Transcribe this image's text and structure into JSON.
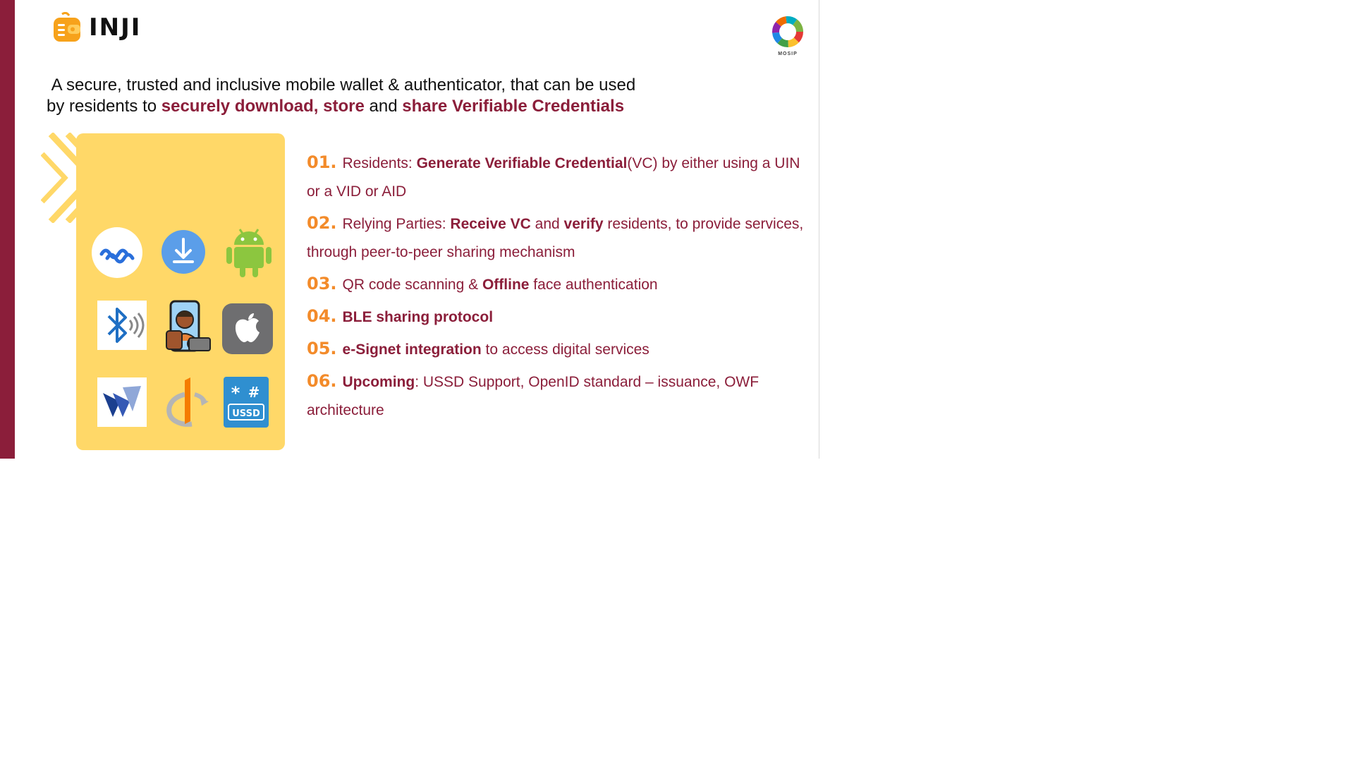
{
  "brand": {
    "name": "INJI",
    "partner_mark": "MOSIP"
  },
  "colors": {
    "maroon": "#8b1e3a",
    "orange": "#f38b2a",
    "card": "#ffd868"
  },
  "tagline": {
    "line1": "A secure, trusted and inclusive mobile wallet & authenticator, that can be used",
    "line2_prefix": "by residents to ",
    "highlight1": "securely download, store",
    "and": " and ",
    "highlight2": "share Verifiable Credentials"
  },
  "icons": [
    "wave-app-icon",
    "download-icon",
    "android-icon",
    "bluetooth-icon",
    "face-auth-icon",
    "apple-icon",
    "walt-icon",
    "openid-icon",
    "ussd-icon"
  ],
  "features": [
    {
      "num": "01.",
      "a": "Residents: ",
      "b": "Generate Verifiable Credential",
      "c": "(VC) by either using a UIN or a VID or AID"
    },
    {
      "num": "02.",
      "a": "Relying Parties: ",
      "b": "Receive VC",
      "c": " and ",
      "d": "verify",
      "e": " residents, to provide services, through peer-to-peer sharing mechanism"
    },
    {
      "num": "03.",
      "a": "QR code scanning & ",
      "b": "Offline",
      "c": " face authentication"
    },
    {
      "num": "04.",
      "b": "BLE sharing protocol"
    },
    {
      "num": "05.",
      "b": "e-Signet integration",
      "c": " to access digital services"
    },
    {
      "num": "06.",
      "b": "Upcoming",
      "c": ": USSD Support, OpenID standard – issuance, OWF architecture"
    }
  ]
}
